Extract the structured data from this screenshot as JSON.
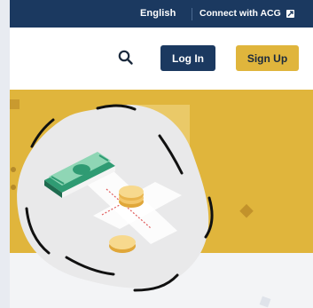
{
  "topbar": {
    "language": "English",
    "connect_label": "Connect with ACG",
    "external_icon": "external-link-icon"
  },
  "header": {
    "search_icon": "search-icon",
    "login_label": "Log In",
    "signup_label": "Sign Up"
  },
  "hero": {
    "illustration": "money-transfer-illustration"
  },
  "colors": {
    "navy": "#1b3960",
    "gold": "#e0b53c",
    "light_bg": "#f3f4f6"
  }
}
